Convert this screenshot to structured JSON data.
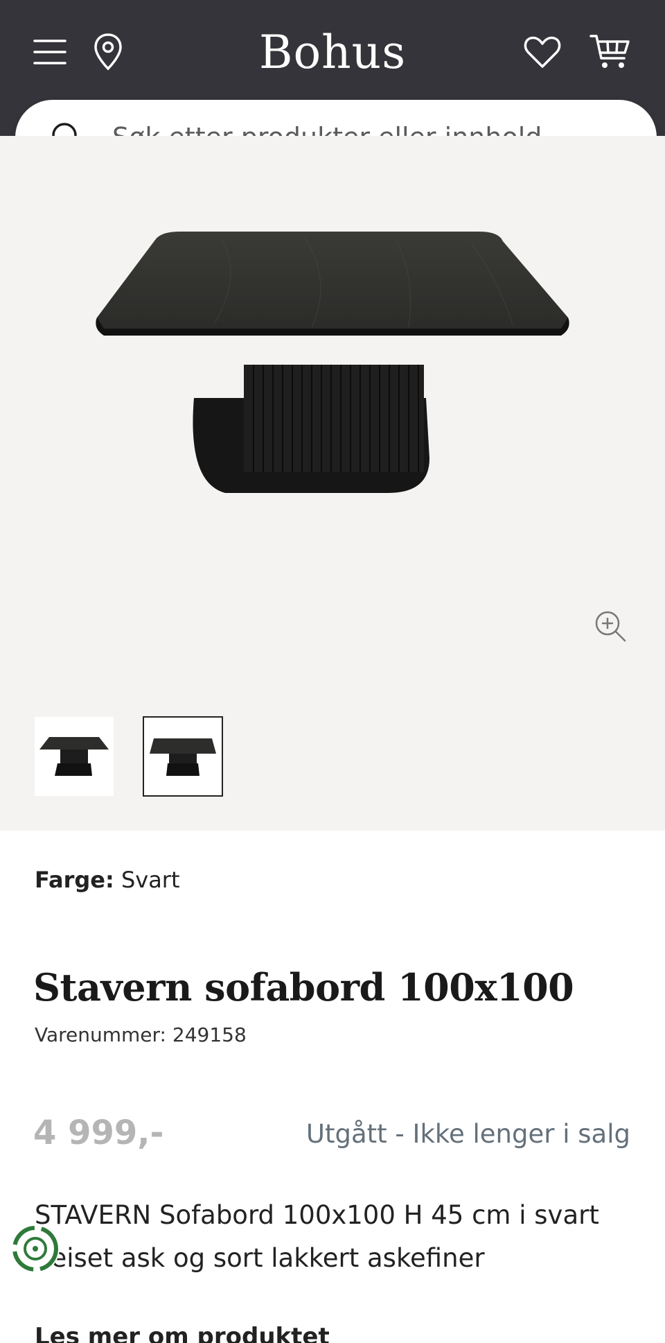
{
  "header": {
    "logo": "Bohus",
    "icons": {
      "menu": "hamburger-icon",
      "store": "location-pin-icon",
      "wishlist": "heart-icon",
      "cart": "cart-icon"
    }
  },
  "search": {
    "placeholder": "Søk etter produkter eller innhold ..."
  },
  "product": {
    "color_label": "Farge:",
    "color_value": "Svart",
    "title": "Stavern sofabord 100x100",
    "sku": "Varenummer: 249158",
    "price": "4 999,-",
    "status": "Utgått - Ikke lenger i salg",
    "description": "STAVERN Sofabord 100x100 H 45 cm i svart\nbeiset ask og sort lakkert askefiner",
    "read_more": "Les mer om produktet"
  },
  "colors": {
    "header_bg": "#34343a",
    "gallery_bg": "#f4f3f1",
    "status": "#64707a",
    "price": "#b5b5b5"
  }
}
